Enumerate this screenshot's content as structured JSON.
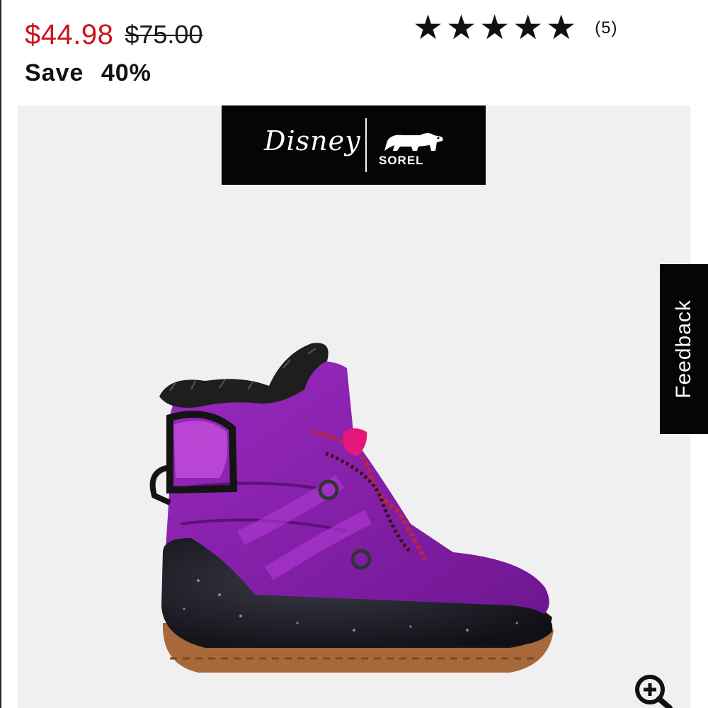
{
  "pricing": {
    "sale_price": "$44.98",
    "original_price": "$75.00",
    "save_text": "Save 40%"
  },
  "rating": {
    "stars": 5,
    "max_stars": 5,
    "count_label": "(5)"
  },
  "brand_banner": {
    "disney_logo_text": "Disney",
    "sorel_logo_text": "SOREL"
  },
  "feedback_tab": {
    "label": "Feedback"
  },
  "icons": {
    "zoom": "zoom-in-icon",
    "bear": "polar-bear-icon"
  },
  "colors": {
    "sale_price": "#c8151b",
    "banner_bg": "#050505",
    "panel_bg": "#f0f0f0",
    "boot_purple": "#8a1fa8"
  }
}
